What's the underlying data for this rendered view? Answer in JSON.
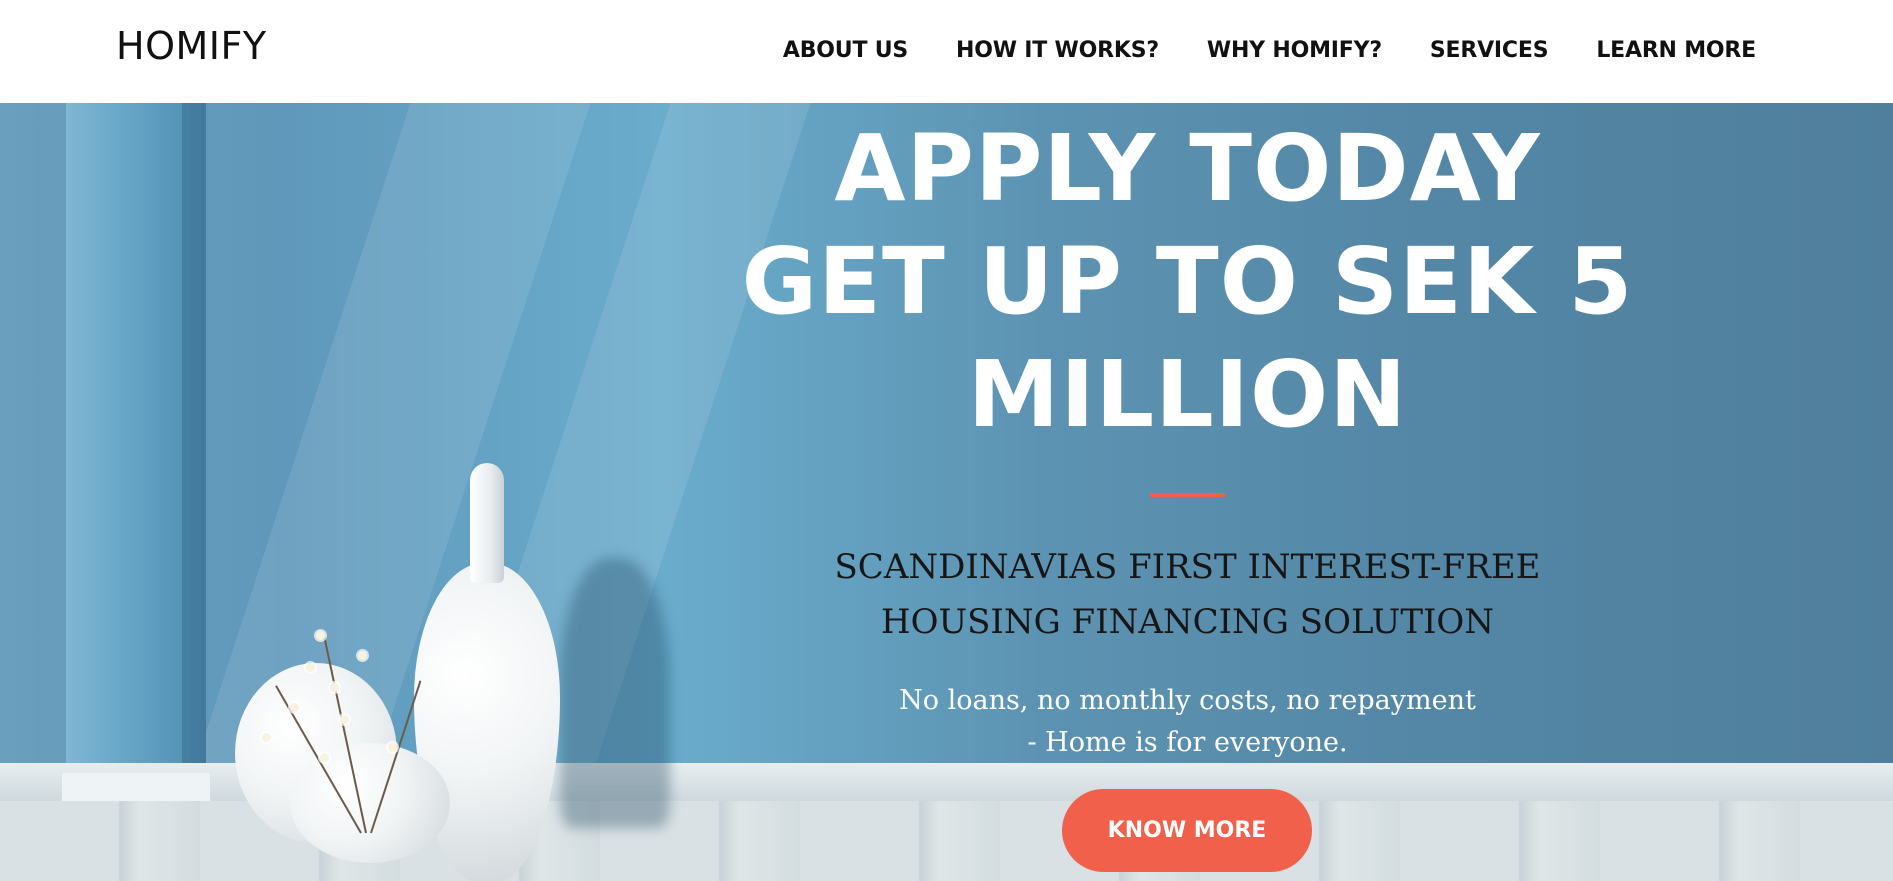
{
  "header": {
    "logo": "HOMIFY",
    "nav": [
      {
        "label": "ABOUT US"
      },
      {
        "label": "HOW IT WORKS?"
      },
      {
        "label": "WHY HOMIFY?"
      },
      {
        "label": "SERVICES"
      },
      {
        "label": "LEARN MORE"
      }
    ]
  },
  "hero": {
    "headline_lines": [
      "APPLY TODAY",
      "GET UP TO SEK 5",
      "MILLION"
    ],
    "subtitle_lines": [
      "SCANDINAVIAS FIRST INTEREST-FREE",
      "HOUSING FINANCING SOLUTION"
    ],
    "tagline_lines": [
      "No loans, no monthly costs, no repayment",
      "- Home is for everyone."
    ],
    "cta_label": "KNOW MORE",
    "accent_color": "#f0604a"
  }
}
